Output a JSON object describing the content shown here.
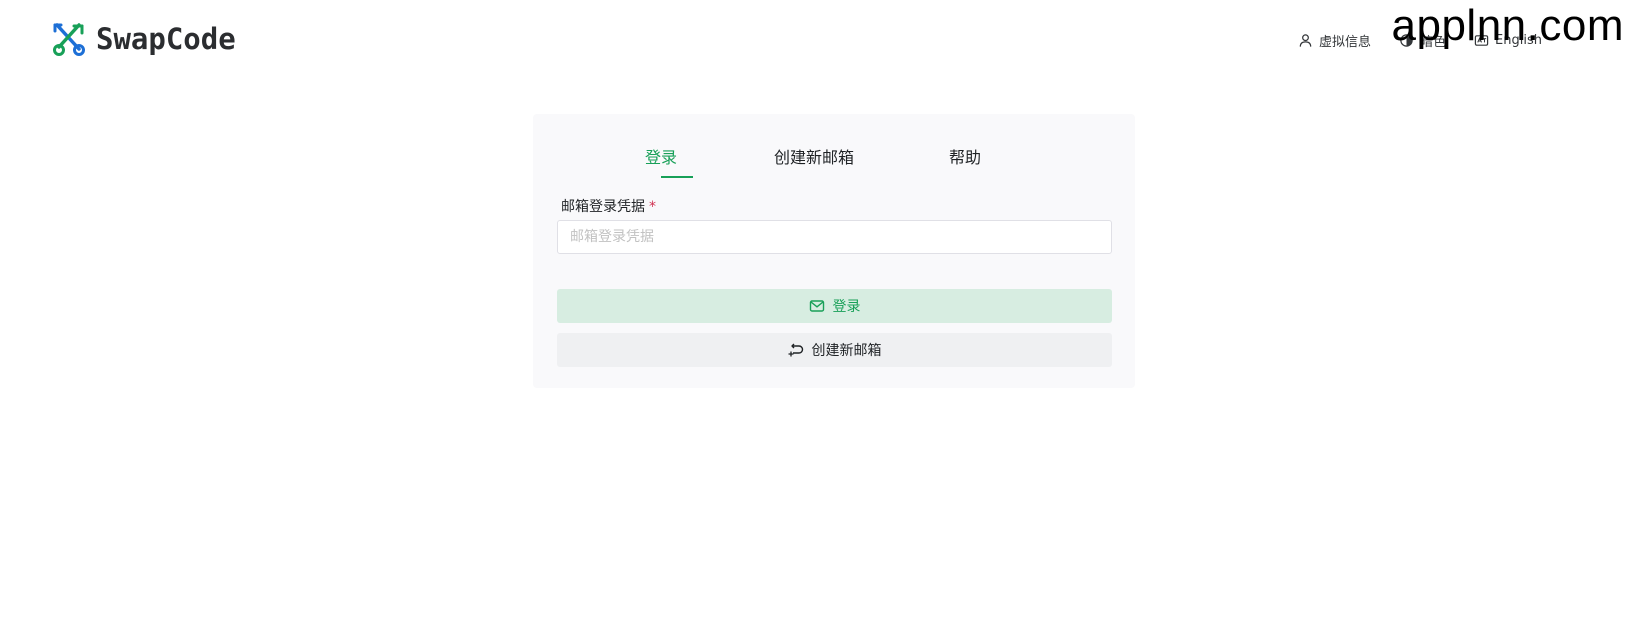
{
  "header": {
    "logo_text": "SwapCode",
    "nav": [
      {
        "label": "虚拟信息",
        "icon": "user-icon"
      },
      {
        "label": "暗色",
        "icon": "theme-icon"
      },
      {
        "label": "English",
        "icon": "language-icon"
      }
    ],
    "watermark": "applnn.com"
  },
  "tabs": [
    {
      "label": "登录",
      "active": true
    },
    {
      "label": "创建新邮箱",
      "active": false
    },
    {
      "label": "帮助",
      "active": false
    }
  ],
  "form": {
    "field_label": "邮箱登录凭据",
    "required_mark": "*",
    "placeholder": "邮箱登录凭据",
    "value": ""
  },
  "buttons": {
    "login": {
      "label": "登录",
      "icon": "mail-icon"
    },
    "create": {
      "label": "创建新邮箱",
      "icon": "reply-plus-icon"
    }
  },
  "colors": {
    "accent": "#18a058",
    "login_button_bg": "#d7ede1",
    "secondary_button_bg": "#eff0f2",
    "card_bg": "#f9f9fb",
    "required": "#d03050"
  }
}
